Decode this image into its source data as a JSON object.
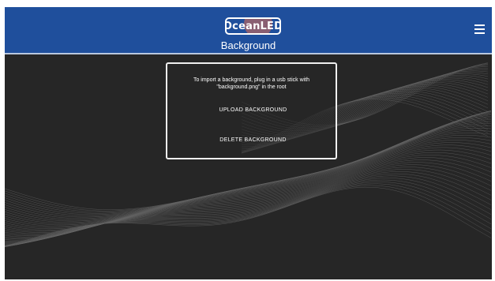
{
  "header": {
    "logo_text": "OceanLED",
    "title": "Background",
    "menu_icon": "hamburger-menu-icon"
  },
  "dialog": {
    "info_line1": "To import a background, plug in a usb stick with",
    "info_line2": "\"background.png\" in the root",
    "upload_label": "UPLOAD BACKGROUND",
    "delete_label": "DELETE BACKGROUND"
  },
  "colors": {
    "header_bg": "#1f4f9c",
    "body_bg": "#262626",
    "text": "#ffffff"
  }
}
